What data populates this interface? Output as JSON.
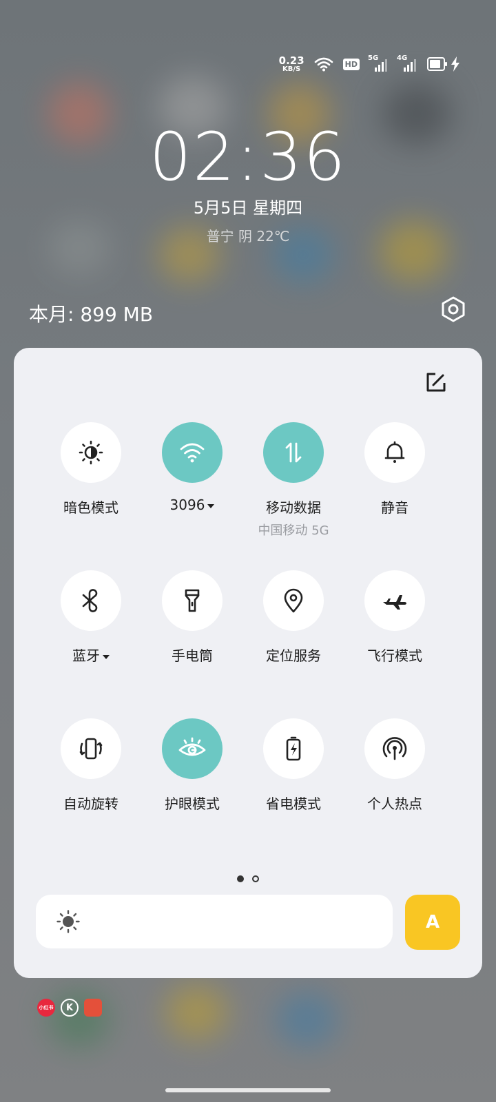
{
  "status_bar": {
    "net_speed": "0.23",
    "net_speed_unit": "KB/S",
    "hd_label": "HD",
    "sim1_label": "5G",
    "sim2_label": "4G",
    "battery_level": 0.85,
    "battery_charging": true
  },
  "lock": {
    "time": "02:36",
    "date": "5月5日  星期四",
    "weather": "普宁 阴 22℃"
  },
  "data_usage": "本月: 899 MB",
  "tiles": [
    {
      "label": "暗色模式",
      "sub": "",
      "icon": "brightness-contrast-icon",
      "on": false,
      "caret": false
    },
    {
      "label": "3096",
      "sub": "",
      "icon": "wifi-icon",
      "on": true,
      "caret": true
    },
    {
      "label": "移动数据",
      "sub": "中国移动 5G",
      "icon": "mobile-data-icon",
      "on": true,
      "caret": false
    },
    {
      "label": "静音",
      "sub": "",
      "icon": "bell-icon",
      "on": false,
      "caret": false
    },
    {
      "label": "蓝牙",
      "sub": "",
      "icon": "bluetooth-icon",
      "on": false,
      "caret": true
    },
    {
      "label": "手电筒",
      "sub": "",
      "icon": "flashlight-icon",
      "on": false,
      "caret": false
    },
    {
      "label": "定位服务",
      "sub": "",
      "icon": "location-pin-icon",
      "on": false,
      "caret": false
    },
    {
      "label": "飞行模式",
      "sub": "",
      "icon": "airplane-icon",
      "on": false,
      "caret": false
    },
    {
      "label": "自动旋转",
      "sub": "",
      "icon": "auto-rotate-icon",
      "on": false,
      "caret": false
    },
    {
      "label": "护眼模式",
      "sub": "",
      "icon": "eye-icon",
      "on": true,
      "caret": false
    },
    {
      "label": "省电模式",
      "sub": "",
      "icon": "battery-saver-icon",
      "on": false,
      "caret": false
    },
    {
      "label": "个人热点",
      "sub": "",
      "icon": "hotspot-icon",
      "on": false,
      "caret": false
    }
  ],
  "page_indicator": {
    "current": 1,
    "total": 2
  },
  "brightness_icon": "sun-icon",
  "auto_brightness_label": "A",
  "notification_icons": [
    {
      "name": "xiaohongshu-icon",
      "text": "小红书",
      "color": "#e8283e"
    },
    {
      "name": "k-app-icon",
      "text": "K",
      "color": "#ffffff"
    },
    {
      "name": "red-app-icon",
      "text": "",
      "color": "#e4503a"
    }
  ],
  "colors": {
    "accent": "#6cc8c3",
    "auto_button": "#f9c623",
    "panel": "#eff0f4"
  }
}
